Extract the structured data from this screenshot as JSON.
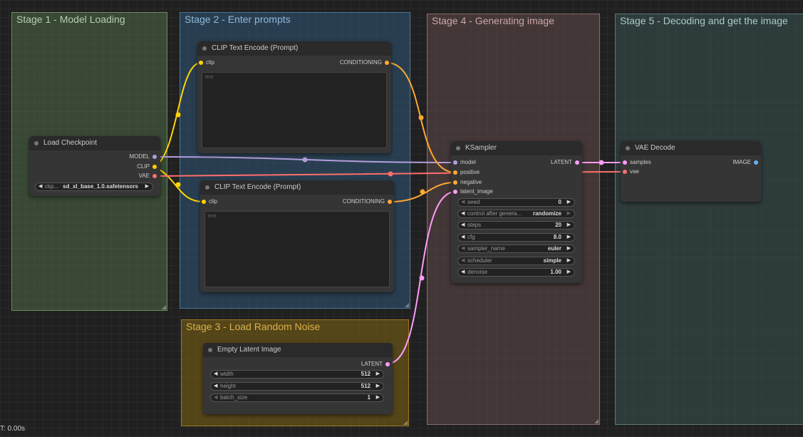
{
  "groups": {
    "stage1": "Stage 1 - Model Loading",
    "stage2": "Stage 2 - Enter prompts",
    "stage3": "Stage 3 - Load Random Noise",
    "stage4": "Stage 4 - Generating image",
    "stage5": "Stage 5 - Decoding and get the image"
  },
  "nodes": {
    "load_checkpoint": {
      "title": "Load Checkpoint",
      "outputs": [
        "MODEL",
        "CLIP",
        "VAE"
      ],
      "ckpt_label": "ckp...",
      "ckpt_value": "sd_xl_base_1.0.safetensors"
    },
    "clip1": {
      "title": "CLIP Text Encode (Prompt)",
      "input": "clip",
      "output": "CONDITIONING",
      "placeholder": "text"
    },
    "clip2": {
      "title": "CLIP Text Encode (Prompt)",
      "input": "clip",
      "output": "CONDITIONING",
      "placeholder": "text"
    },
    "ksampler": {
      "title": "KSampler",
      "inputs": [
        "model",
        "positive",
        "negative",
        "latent_image"
      ],
      "output": "LATENT",
      "widgets": [
        {
          "label": "seed",
          "value": "0"
        },
        {
          "label": "control after genera...",
          "value": "randomize"
        },
        {
          "label": "steps",
          "value": "20"
        },
        {
          "label": "cfg",
          "value": "8.0"
        },
        {
          "label": "sampler_name",
          "value": "euler"
        },
        {
          "label": "scheduler",
          "value": "simple"
        },
        {
          "label": "denoise",
          "value": "1.00"
        }
      ]
    },
    "vae_decode": {
      "title": "VAE Decode",
      "inputs": [
        "samples",
        "vae"
      ],
      "output": "IMAGE"
    },
    "empty_latent": {
      "title": "Empty Latent Image",
      "output": "LATENT",
      "widgets": [
        {
          "label": "width",
          "value": "512"
        },
        {
          "label": "height",
          "value": "512"
        },
        {
          "label": "batch_size",
          "value": "1"
        }
      ]
    }
  },
  "colors": {
    "model": "#b39ddb",
    "clip": "#ffd500",
    "vae": "#ff6e6e",
    "conditioning": "#ffa931",
    "latent": "#ff9cf9",
    "image": "#64b5f6"
  },
  "footer": {
    "time": "T: 0.00s"
  }
}
